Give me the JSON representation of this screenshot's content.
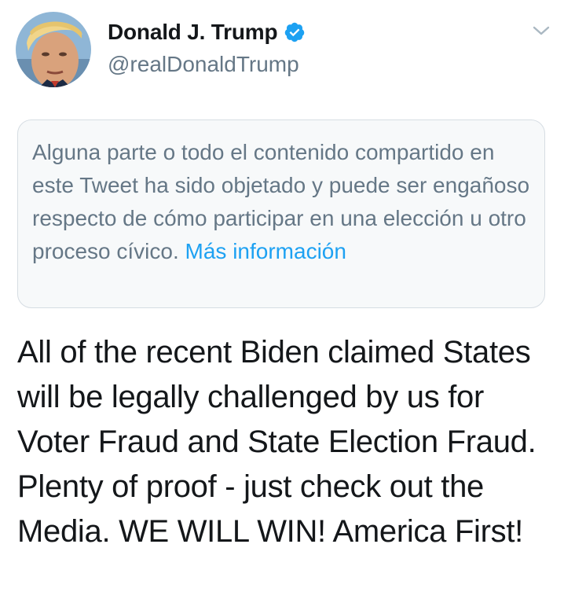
{
  "author": {
    "display_name": "Donald J. Trump",
    "handle": "@realDonaldTrump",
    "verified": true,
    "avatar_icon": "profile-photo"
  },
  "menu": {
    "icon": "chevron-down-icon"
  },
  "notice": {
    "text": "Alguna parte o todo el contenido compartido en este Tweet ha sido objetado y puede ser engañoso respecto de cómo participar en una elección u otro proceso cívico.",
    "link_text": "Más información"
  },
  "tweet": {
    "text": "All of the recent Biden claimed States will be legally challenged by us for Voter Fraud and State Election Fraud. Plenty of proof - just check out the Media. WE WILL WIN! America First!"
  },
  "colors": {
    "text_primary": "#14171a",
    "text_secondary": "#657786",
    "link": "#1da1f2",
    "notice_bg": "#f7f9fa",
    "notice_border": "#d6dde3"
  }
}
